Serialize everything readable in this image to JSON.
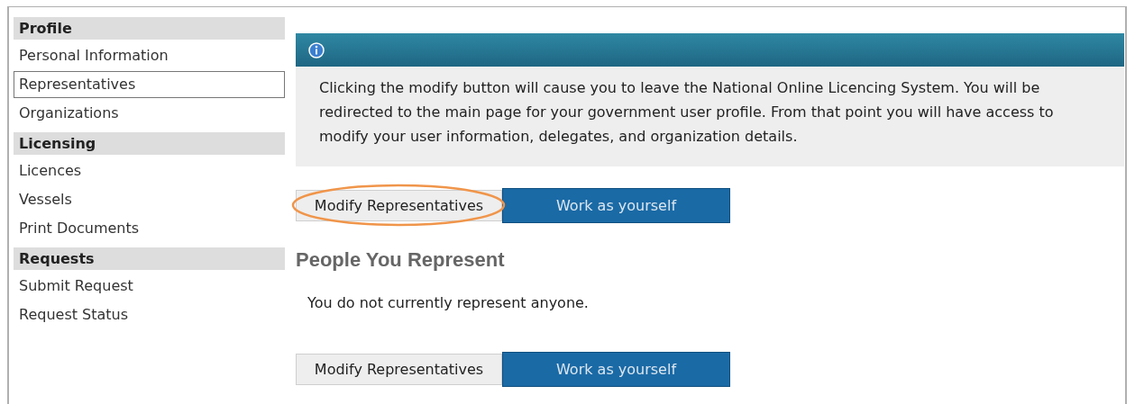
{
  "sidebar": {
    "sections": [
      {
        "title": "Profile",
        "items": [
          {
            "label": "Personal Information",
            "selected": false
          },
          {
            "label": "Representatives",
            "selected": true
          },
          {
            "label": "Organizations",
            "selected": false
          }
        ]
      },
      {
        "title": "Licensing",
        "items": [
          {
            "label": "Licences",
            "selected": false
          },
          {
            "label": "Vessels",
            "selected": false
          },
          {
            "label": "Print Documents",
            "selected": false
          }
        ]
      },
      {
        "title": "Requests",
        "items": [
          {
            "label": "Submit Request",
            "selected": false
          },
          {
            "label": "Request Status",
            "selected": false
          }
        ]
      }
    ]
  },
  "info_box": {
    "message": "Clicking the modify button will cause you to leave the National Online Licencing System. You will be redirected to the main page for your government user profile. From that point you will have access to modify your user information, delegates, and organization details."
  },
  "top_actions": {
    "buttons": [
      {
        "label": "Modify Representatives",
        "kind": "secondary"
      },
      {
        "label": "Work as yourself",
        "kind": "primary"
      }
    ],
    "highlighted": true
  },
  "section": {
    "heading": "People You Represent",
    "empty_message": "You do not currently represent anyone."
  },
  "bottom_actions": {
    "buttons": [
      {
        "label": "Modify Representatives",
        "kind": "secondary"
      },
      {
        "label": "Work as yourself",
        "kind": "primary"
      }
    ],
    "highlighted": false
  }
}
